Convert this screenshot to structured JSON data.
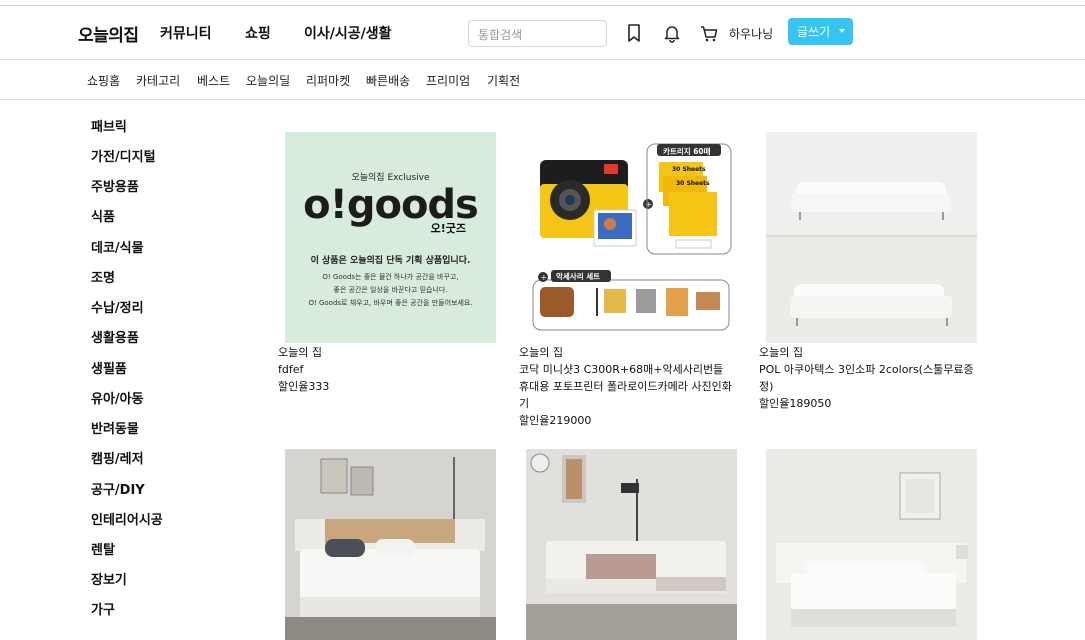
{
  "header": {
    "logo": "오늘의집",
    "nav": [
      "커뮤니티",
      "쇼핑",
      "이사/시공/생활"
    ],
    "search_placeholder": "통합검색",
    "login": "하우나닝",
    "write_button": "글쓰기"
  },
  "icons": [
    "bookmark-icon",
    "bell-icon",
    "cart-icon",
    "chevron-down-icon"
  ],
  "subnav": [
    "쇼핑홈",
    "카테고리",
    "베스트",
    "오늘의딜",
    "리퍼마켓",
    "빠른배송",
    "프리미엄",
    "기획전"
  ],
  "categories": [
    "패브릭",
    "가전/디지털",
    "주방용품",
    "식품",
    "데코/식물",
    "조명",
    "수납/정리",
    "생활용품",
    "생필품",
    "유아/아동",
    "반려동물",
    "캠핑/레저",
    "공구/DIY",
    "인테리어시공",
    "렌탈",
    "장보기",
    "가구"
  ],
  "banner": {
    "top": "오늘의집 Exclusive",
    "brand": "o!goods",
    "brand_sub": "오!굿즈",
    "headline": "이 상품은 오늘의집 단독 기획 상품입니다.",
    "line1": "O! Goods는 좋은 물건 하나가 공간을 바꾸고,",
    "line2": "좋은 공간은 일상을 바꾼다고 믿습니다.",
    "line3": "O! Goods로 채우고, 바우며 좋은 공간을 만들어보세요."
  },
  "camera_image": {
    "badge_top": "카트리지 60매",
    "badge_sheet": "30 Sheets",
    "badge_set": "악세사리 세트"
  },
  "products": [
    {
      "brand": "오늘의 집",
      "name": "fdfef",
      "price": "할인율333"
    },
    {
      "brand": "오늘의 집",
      "name": "코닥 미니샷3 C300R+68매+악세사리번들 휴대용 포토프린터 폴라로이드카메라 사진인화기",
      "price": "할인율219000"
    },
    {
      "brand": "오늘의 집",
      "name": "POL 아쿠아텍스 3인소파 2colors(스툴무료증정)",
      "price": "할인율189050"
    }
  ]
}
